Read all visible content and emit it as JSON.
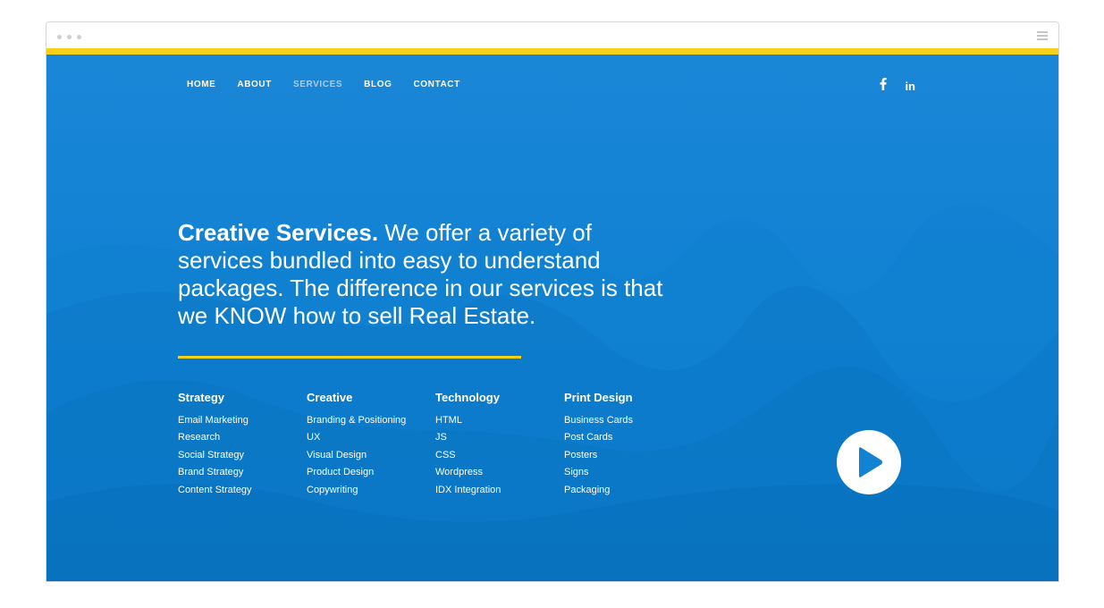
{
  "nav": {
    "items": [
      {
        "label": "HOME",
        "active": false
      },
      {
        "label": "ABOUT",
        "active": false
      },
      {
        "label": "SERVICES",
        "active": true
      },
      {
        "label": "BLOG",
        "active": false
      },
      {
        "label": "CONTACT",
        "active": false
      }
    ]
  },
  "social": {
    "icons": [
      "facebook-icon",
      "linkedin-icon"
    ],
    "linkedin_label": "in"
  },
  "hero": {
    "headline_bold": "Creative Services.",
    "headline_rest": " We offer a variety of services bundled into easy to understand packages. The difference in our services is that we KNOW how to sell Real Estate."
  },
  "services": [
    {
      "title": "Strategy",
      "items": [
        "Email Marketing",
        "Research",
        "Social Strategy",
        "Brand Strategy",
        "Content Strategy"
      ]
    },
    {
      "title": "Creative",
      "items": [
        "Branding & Positioning",
        "UX",
        "Visual Design",
        "Product Design",
        "Copywriting"
      ]
    },
    {
      "title": "Technology",
      "items": [
        "HTML",
        "JS",
        "CSS",
        "Wordpress",
        "IDX Integration"
      ]
    },
    {
      "title": "Print Design",
      "items": [
        "Business Cards",
        "Post Cards",
        "Posters",
        "Signs",
        "Packaging"
      ]
    }
  ],
  "colors": {
    "accent": "#f7d117",
    "hero_blue": "#1282d3",
    "nav_active": "#a9cdee"
  },
  "icons": {
    "play": "play-icon",
    "window_menu": "hamburger-menu-icon"
  }
}
